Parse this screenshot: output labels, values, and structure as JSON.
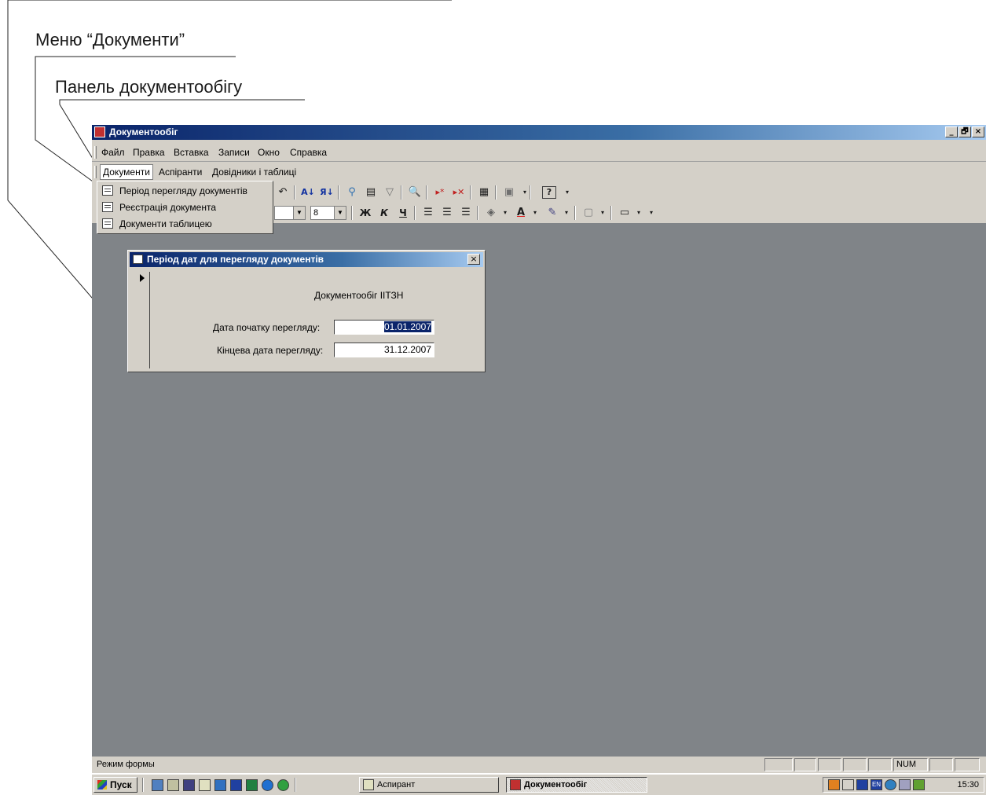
{
  "annotations": {
    "documents_menu": "Меню “Документи”",
    "documents_panel": "Панель документообігу"
  },
  "window": {
    "title": "Документообіг",
    "controls": {
      "minimize": "_",
      "maximize": "🗗",
      "close": "×"
    }
  },
  "menubar": {
    "items": [
      {
        "label": "Файл"
      },
      {
        "label": "Правка"
      },
      {
        "label": "Вставка"
      },
      {
        "label": "Записи"
      },
      {
        "label": "Окно"
      },
      {
        "label": "Справка"
      }
    ]
  },
  "docbar": {
    "items": [
      {
        "label": "Документи"
      },
      {
        "label": "Аспіранти"
      },
      {
        "label": "Довідники і таблиці"
      }
    ]
  },
  "toolbar1": {
    "icons": [
      "undo-icon",
      "sort-ascending-icon",
      "sort-descending-icon",
      "filter-by-selection-icon",
      "filter-by-form-icon",
      "apply-filter-icon",
      "find-icon",
      "new-record-icon",
      "delete-record-icon",
      "properties-icon",
      "database-window-icon",
      "help-icon"
    ],
    "glyphs": {
      "undo": "↶",
      "sort_asc": "A↓",
      "sort_desc": "Я↓",
      "filter_sel": "⚲",
      "filter_form": "▤",
      "apply_filter": "▽",
      "find": "🔍",
      "new_record": "▸*",
      "delete_record": "▸✕",
      "properties": "▦",
      "db_window": "▣",
      "help": "?"
    }
  },
  "toolbar2": {
    "font_size": "8",
    "bold": "Ж",
    "italic": "К",
    "underline": "Ч",
    "icons": [
      "align-left-icon",
      "align-center-icon",
      "align-right-icon",
      "fill-color-icon",
      "font-color-icon",
      "line-color-icon",
      "border-icon",
      "special-effect-icon"
    ]
  },
  "dropdown": {
    "items": [
      {
        "label": "Період перегляду документів"
      },
      {
        "label": "Реєстрація документа"
      },
      {
        "label": "Документи таблицею"
      }
    ]
  },
  "dialog": {
    "title": "Період дат для перегляду документів",
    "close": "×",
    "heading": "Документообіг ІІТЗН",
    "start_label": "Дата початку перегляду:",
    "start_value": "01.01.2007",
    "end_label": "Кінцева дата перегляду:",
    "end_value": "31.12.2007"
  },
  "statusbar": {
    "mode": "Режим формы",
    "num": "NUM"
  },
  "taskbar": {
    "start": "Пуск",
    "tasks": [
      {
        "label": "Аспирант"
      },
      {
        "label": "Документообіг"
      }
    ],
    "clock": "15:30",
    "lang": "EN"
  },
  "colors": {
    "desktop_gray": "#808488",
    "face": "#d4d0c8",
    "title_dark": "#0a246a",
    "title_light": "#a6caf0"
  }
}
